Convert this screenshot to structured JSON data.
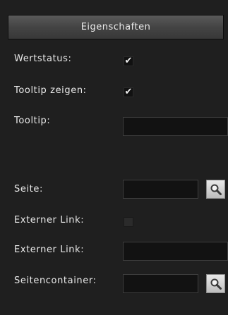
{
  "header": {
    "title": "Eigenschaften"
  },
  "rows": {
    "wertstatus": {
      "label": "Wertstatus:",
      "checked": true
    },
    "tooltip_zeigen": {
      "label": "Tooltip zeigen:",
      "checked": true
    },
    "tooltip": {
      "label": "Tooltip:",
      "value": ""
    },
    "seite": {
      "label": "Seite:",
      "value": ""
    },
    "externer_link_toggle": {
      "label": "Externer Link:",
      "checked": false
    },
    "externer_link": {
      "label": "Externer Link:",
      "value": ""
    },
    "seitencontainer": {
      "label": "Seitencontainer:",
      "value": ""
    }
  },
  "icons": {
    "check": "✔",
    "search": "search-icon"
  }
}
